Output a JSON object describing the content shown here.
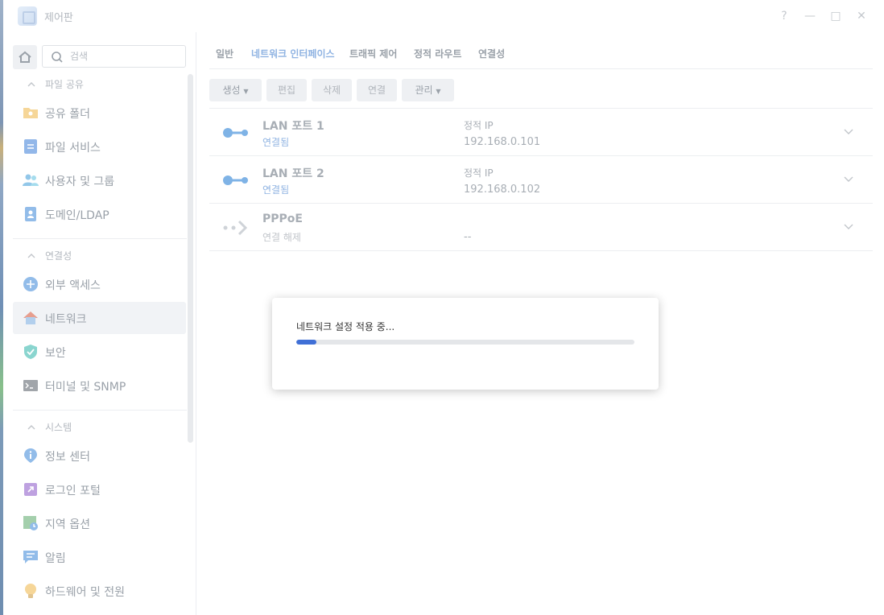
{
  "window": {
    "title": "제어판",
    "controls": {
      "help": "?",
      "minimize": "—",
      "maximize": "□",
      "close": "✕"
    }
  },
  "sidebar": {
    "search": {
      "placeholder": "검색",
      "value": ""
    },
    "sections": [
      {
        "label": "파일 공유",
        "items": [
          {
            "label": "공유 폴더",
            "icon": "shared-folder-icon"
          },
          {
            "label": "파일 서비스",
            "icon": "file-services-icon"
          },
          {
            "label": "사용자 및 그룹",
            "icon": "users-groups-icon"
          },
          {
            "label": "도메인/LDAP",
            "icon": "domain-ldap-icon"
          }
        ]
      },
      {
        "label": "연결성",
        "items": [
          {
            "label": "외부 액세스",
            "icon": "external-access-icon"
          },
          {
            "label": "네트워크",
            "icon": "network-house-icon",
            "active": true
          },
          {
            "label": "보안",
            "icon": "security-shield-icon"
          },
          {
            "label": "터미널 및 SNMP",
            "icon": "terminal-icon"
          }
        ]
      },
      {
        "label": "시스템",
        "items": [
          {
            "label": "정보 센터",
            "icon": "info-center-icon"
          },
          {
            "label": "로그인 포털",
            "icon": "login-portal-icon"
          },
          {
            "label": "지역 옵션",
            "icon": "regional-options-icon"
          },
          {
            "label": "알림",
            "icon": "notification-icon"
          },
          {
            "label": "하드웨어 및 전원",
            "icon": "hardware-power-icon"
          }
        ]
      }
    ]
  },
  "main": {
    "tabs": [
      {
        "label": "일반"
      },
      {
        "label": "네트워크 인터페이스",
        "active": true
      },
      {
        "label": "트래픽 제어"
      },
      {
        "label": "정적 라우트"
      },
      {
        "label": "연결성"
      }
    ],
    "toolbar": {
      "create": "생성",
      "edit": "편집",
      "delete": "삭제",
      "connect": "연결",
      "manage": "관리"
    },
    "interfaces": [
      {
        "name": "LAN 포트 1",
        "status": "연결됨",
        "type": "정적 IP",
        "ip": "192.168.0.101"
      },
      {
        "name": "LAN 포트 2",
        "status": "연결됨",
        "type": "정적 IP",
        "ip": "192.168.0.102"
      },
      {
        "name": "PPPoE",
        "status": "연결 해제",
        "type": "",
        "ip": "--"
      }
    ]
  },
  "dialog": {
    "message": "네트워크 설정 적용 중...",
    "progress": 0.06,
    "accent": "#3f6fd6"
  }
}
